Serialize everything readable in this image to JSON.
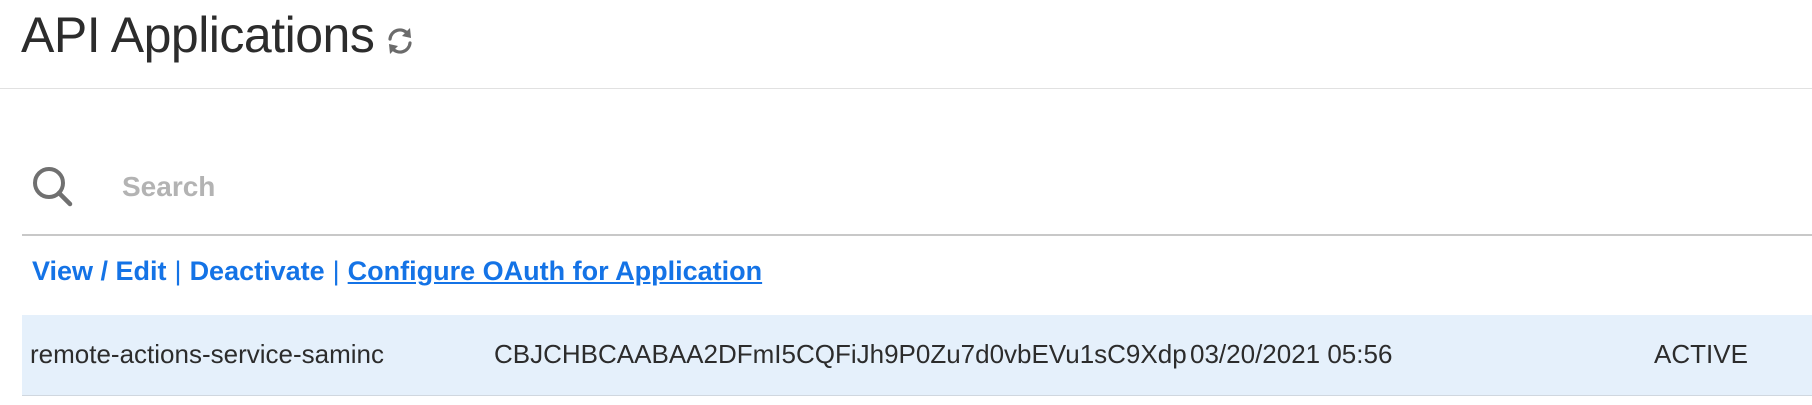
{
  "header": {
    "title": "API Applications",
    "refresh_icon": "refresh-icon"
  },
  "search": {
    "placeholder": "Search",
    "value": "",
    "icon": "search-icon"
  },
  "actions": {
    "view_edit": "View / Edit",
    "separator": "|",
    "deactivate": "Deactivate",
    "configure_oauth": "Configure OAuth for Application"
  },
  "applications": [
    {
      "name": "remote-actions-service-saminc",
      "key": "CBJCHBCAABAA2DFmI5CQFiJh9P0Zu7d0vbEVu1sC9Xdp",
      "date": "03/20/2021 05:56",
      "status": "ACTIVE"
    }
  ],
  "colors": {
    "link": "#1473e6",
    "selected_row": "#e5f0fb",
    "text": "#2c2c2c",
    "placeholder": "#b3b3b3"
  }
}
